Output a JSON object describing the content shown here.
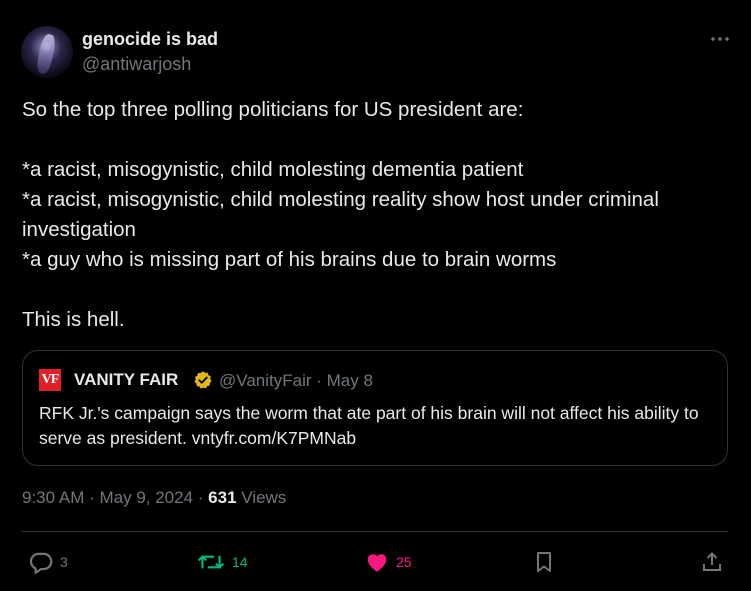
{
  "author": {
    "display_name": "genocide is bad",
    "handle": "@antiwarjosh"
  },
  "tweet": {
    "text": "So the top three polling politicians for US president are:\n\n*a racist, misogynistic, child molesting dementia patient\n*a racist, misogynistic, child molesting reality show host under criminal investigation\n*a guy who is missing part of his brains due to brain worms\n\nThis is hell."
  },
  "quote": {
    "logo_text": "VF",
    "name": "VANITY FAIR",
    "handle_date": "@VanityFair · May 8",
    "text": "RFK Jr.'s campaign says the worm that ate part of his brain will not affect his ability to serve as president.  vntyfr.com/K7PMNab"
  },
  "meta": {
    "timestamp": "9:30 AM · May 9, 2024 · ",
    "views_count": "631",
    "views_label": " Views"
  },
  "actions": {
    "replies": "3",
    "reposts": "14",
    "likes": "25"
  },
  "colors": {
    "background": "#000000",
    "text": "#e7e9ea",
    "muted": "#71767b",
    "repost": "#00ba7c",
    "like": "#f91880",
    "verified_gold": "#e2b719",
    "vf_red": "#e01f26"
  },
  "icons": [
    "more-icon",
    "verified-badge-icon",
    "reply-icon",
    "repost-icon",
    "like-icon",
    "bookmark-icon",
    "share-icon"
  ]
}
